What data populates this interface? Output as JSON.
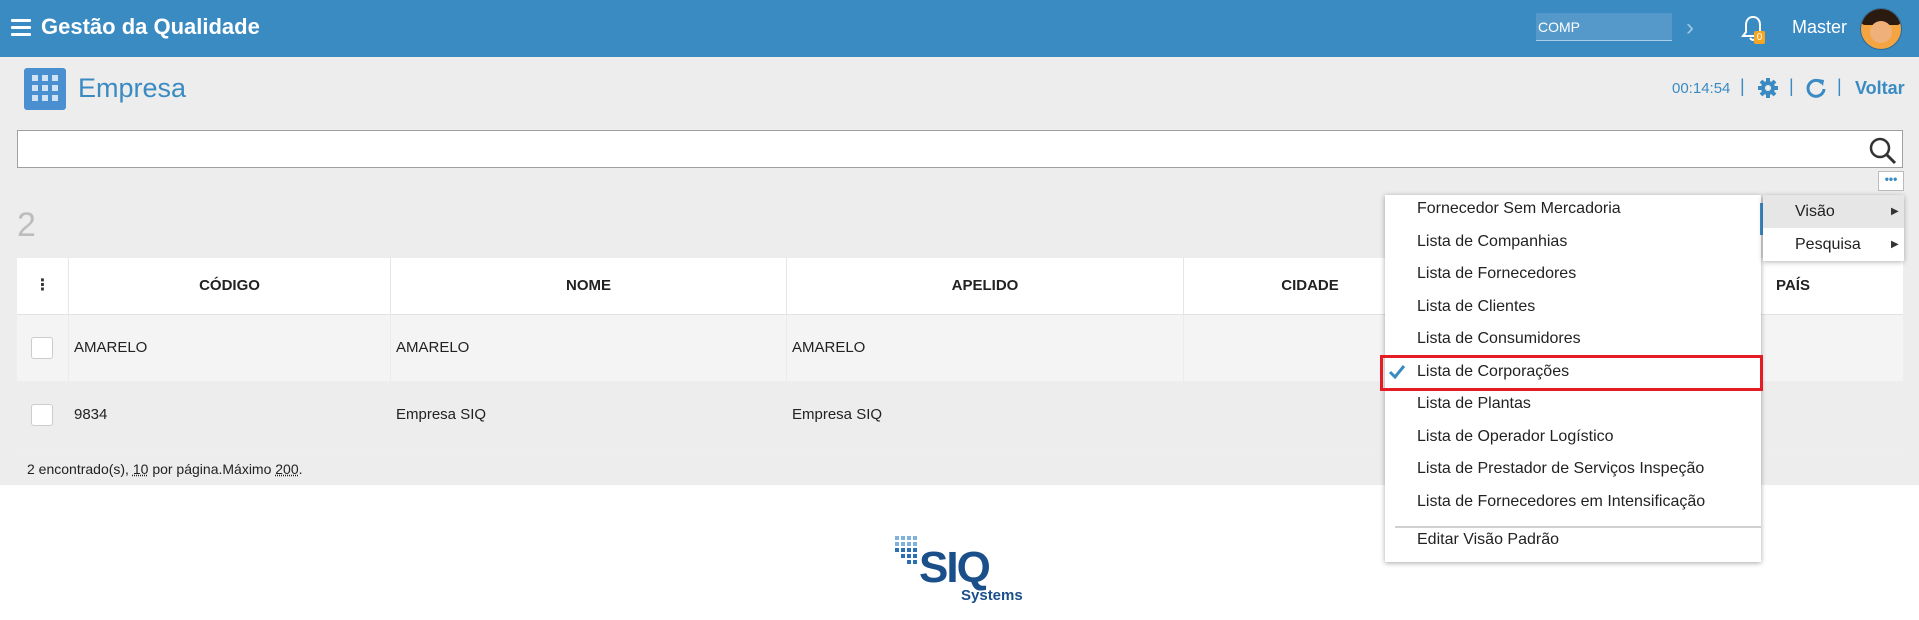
{
  "header": {
    "app_title": "Gestão da Qualidade",
    "company_value": "COMP",
    "notification_count": "0",
    "username": "Master"
  },
  "page": {
    "title": "Empresa",
    "timer": "00:14:54",
    "back_label": "Voltar",
    "result_count": "2"
  },
  "table": {
    "columns": [
      "CÓDIGO",
      "NOME",
      "APELIDO",
      "CIDADE",
      "PAÍS"
    ],
    "rows": [
      {
        "codigo": "AMARELO",
        "nome": "AMARELO",
        "apelido": "AMARELO"
      },
      {
        "codigo": "9834",
        "nome": "Empresa SIQ",
        "apelido": "Empresa SIQ"
      }
    ],
    "footer": {
      "found_text": "2 encontrado(s),",
      "per_page": "10",
      "per_page_text": "por página.Máximo",
      "max": "200",
      "end": "."
    }
  },
  "view_menu": {
    "items": [
      "Fornecedor Sem Mercadoria",
      "Lista de Companhias",
      "Lista de Fornecedores",
      "Lista de Clientes",
      "Lista de Consumidores",
      "Lista de Corporações",
      "Lista de Plantas",
      "Lista de Operador Logístico",
      "Lista de Prestador de Serviços Inspeção",
      "Lista de Fornecedores em Intensificação"
    ],
    "selected_index": 5,
    "edit_default": "Editar Visão Padrão"
  },
  "submenu": {
    "items": [
      "Visão",
      "Pesquisa"
    ]
  },
  "logo": {
    "text": "SIQ",
    "subtext": "Systems"
  },
  "colors": {
    "header_blue": "#3b8bc3",
    "highlight_red": "#e51c23"
  }
}
